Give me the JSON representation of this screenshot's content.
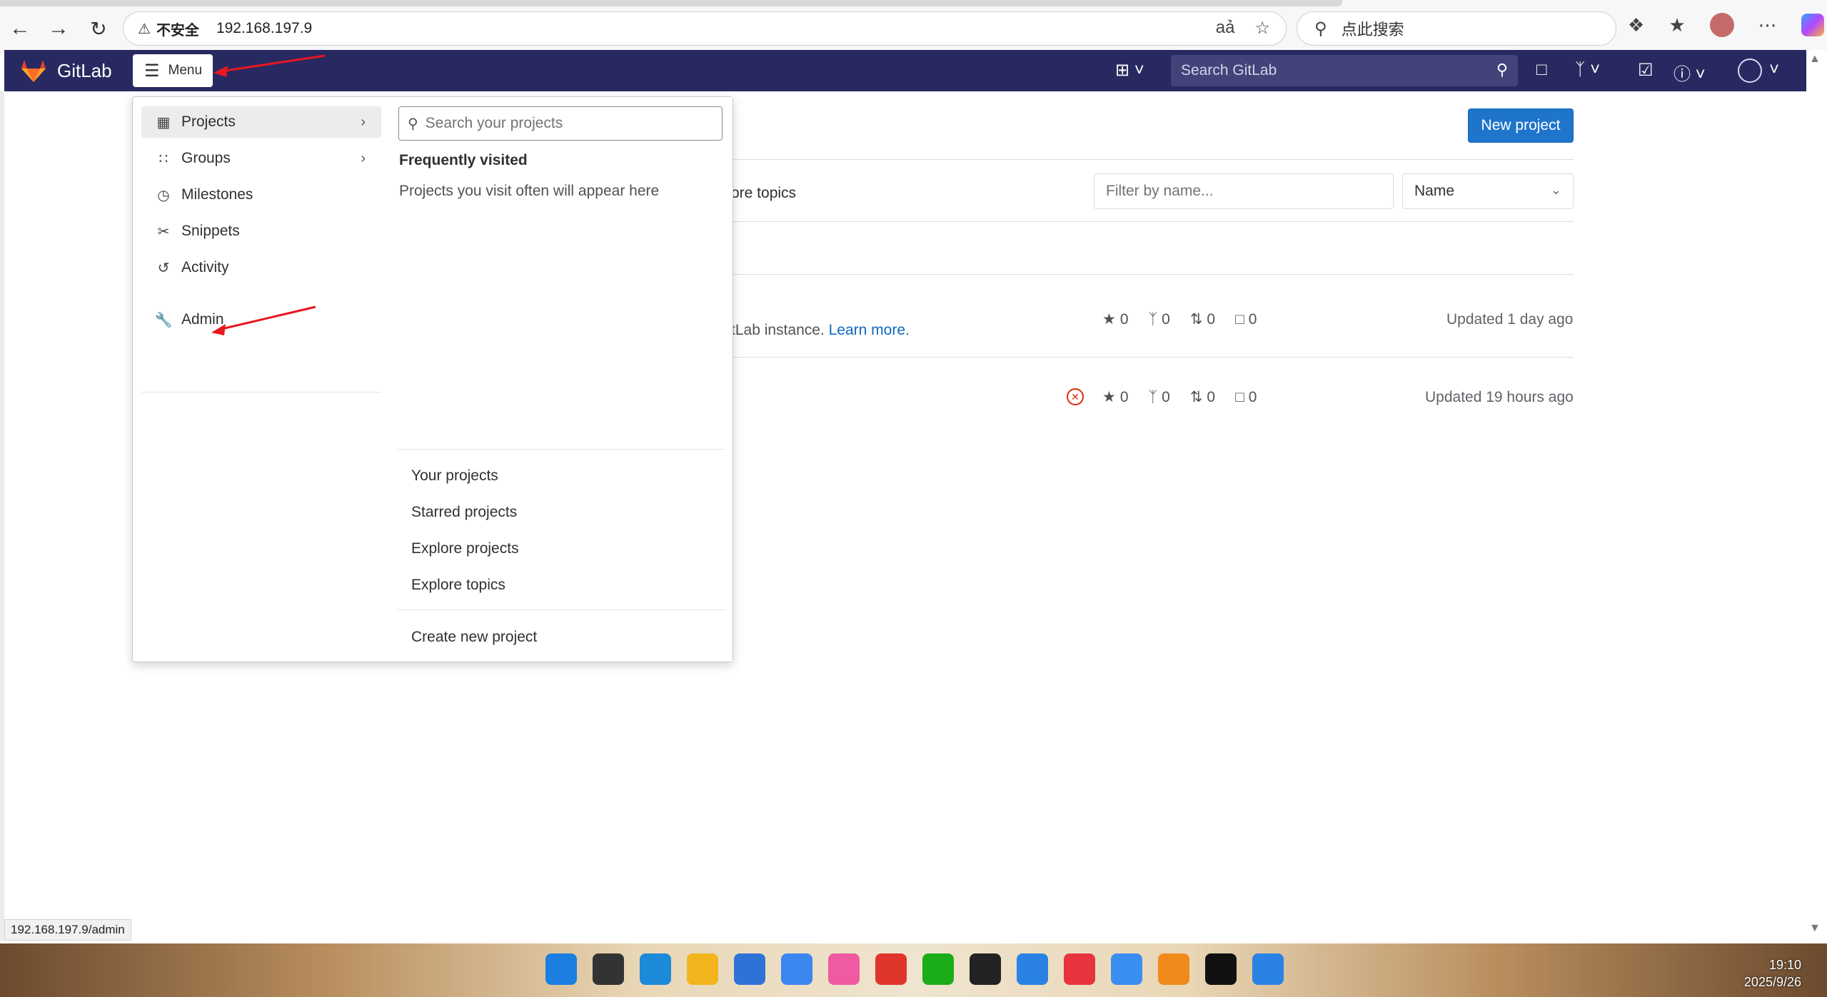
{
  "browser": {
    "security_label": "不安全",
    "url": "192.168.197.9",
    "search_placeholder": "点此搜索"
  },
  "header": {
    "brand": "GitLab",
    "menu_label": "Menu",
    "search_placeholder": "Search GitLab"
  },
  "page": {
    "new_project_label": "New project",
    "tab_partial": "ore topics",
    "filter_placeholder": "Filter by name...",
    "sort_value": "Name",
    "projects": [
      {
        "desc_partial": "tLab instance.",
        "desc_link": "Learn more.",
        "stars": "0",
        "forks": "0",
        "mrs": "0",
        "issues": "0",
        "updated": "Updated 1 day ago"
      },
      {
        "stars": "0",
        "forks": "0",
        "mrs": "0",
        "issues": "0",
        "updated": "Updated 19 hours ago"
      }
    ]
  },
  "menu": {
    "items": [
      {
        "label": "Projects",
        "icon": "project-icon"
      },
      {
        "label": "Groups",
        "icon": "group-icon"
      },
      {
        "label": "Milestones",
        "icon": "clock-icon"
      },
      {
        "label": "Snippets",
        "icon": "scissors-icon"
      },
      {
        "label": "Activity",
        "icon": "history-icon"
      },
      {
        "label": "Admin",
        "icon": "wrench-icon"
      }
    ],
    "search_placeholder": "Search your projects",
    "frequent_heading": "Frequently visited",
    "frequent_empty": "Projects you visit often will appear here",
    "links": [
      "Your projects",
      "Starred projects",
      "Explore projects",
      "Explore topics"
    ],
    "create_label": "Create new project"
  },
  "status_url": "192.168.197.9/admin",
  "clock": {
    "time": "19:10",
    "date": "2025/9/26"
  },
  "colors": {
    "header_bg": "#292961",
    "primary_button": "#1f75cb",
    "annotation_arrow": "#e8171f"
  }
}
